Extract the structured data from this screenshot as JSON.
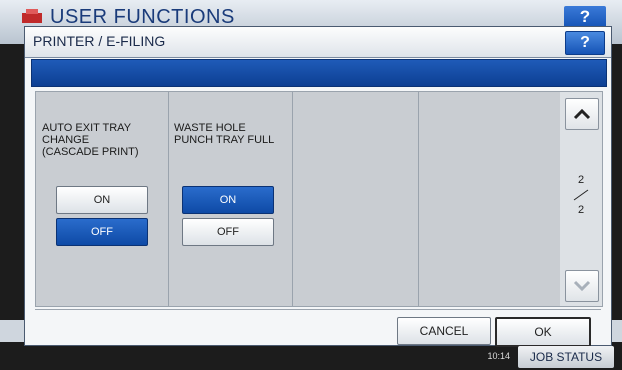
{
  "background": {
    "title": "USER FUNCTIONS",
    "help_label": "?"
  },
  "dialog": {
    "title": "PRINTER / E-FILING",
    "help_label": "?",
    "columns": [
      {
        "label": "AUTO EXIT TRAY\nCHANGE\n(CASCADE PRINT)",
        "on_label": "ON",
        "off_label": "OFF",
        "selected": "OFF"
      },
      {
        "label": "WASTE HOLE\nPUNCH TRAY FULL",
        "on_label": "ON",
        "off_label": "OFF",
        "selected": "ON"
      }
    ],
    "page": {
      "current": "2",
      "total": "2"
    },
    "cancel_label": "CANCEL",
    "ok_label": "OK"
  },
  "status_bar": {
    "time": "10:14",
    "job_status_label": "JOB STATUS"
  },
  "colors": {
    "selected_blue": "#0e4aa6",
    "title_blue": "#1a3b7a"
  },
  "icons": {
    "scroll_up": "chevron-up-icon",
    "scroll_down": "chevron-down-icon",
    "help": "help-icon"
  }
}
